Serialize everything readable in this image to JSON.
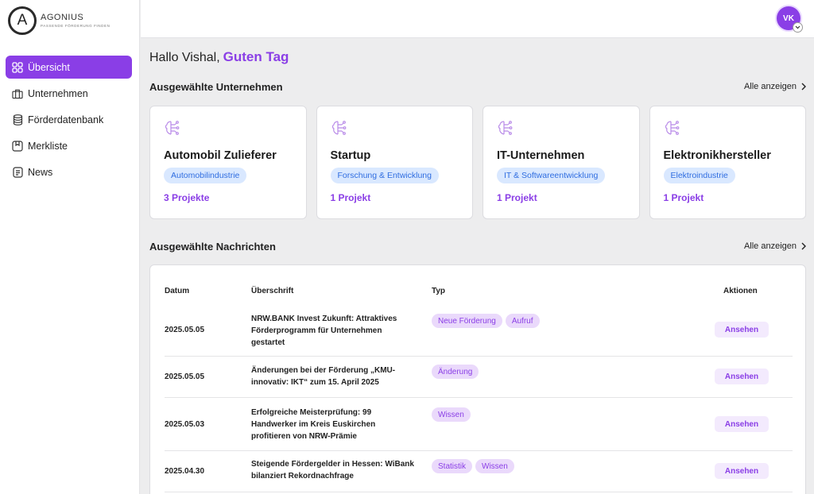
{
  "brand": {
    "letter": "A",
    "name": "AGONIUS",
    "tagline": "PASSENDE FÖRDERUNG FINDEN"
  },
  "nav": [
    {
      "label": "Übersicht",
      "icon": "grid-icon",
      "active": true
    },
    {
      "label": "Unternehmen",
      "icon": "briefcase-icon",
      "active": false
    },
    {
      "label": "Förderdatenbank",
      "icon": "database-icon",
      "active": false
    },
    {
      "label": "Merkliste",
      "icon": "bookmark-icon",
      "active": false
    },
    {
      "label": "News",
      "icon": "document-icon",
      "active": false
    }
  ],
  "user": {
    "initials": "VK"
  },
  "greeting": {
    "text": "Hallo Vishal,",
    "accent": "Guten Tag"
  },
  "companies_section": {
    "title": "Ausgewählte Unternehmen",
    "see_all": "Alle anzeigen"
  },
  "companies": [
    {
      "title": "Automobil Zulieferer",
      "tag": "Automobilindustrie",
      "projects": "3 Projekte"
    },
    {
      "title": "Startup",
      "tag": "Forschung & Entwicklung",
      "projects": "1 Projekt"
    },
    {
      "title": "IT-Unternehmen",
      "tag": "IT & Softwareentwicklung",
      "projects": "1 Projekt"
    },
    {
      "title": "Elektronikhersteller",
      "tag": "Elektroindustrie",
      "projects": "1 Projekt"
    }
  ],
  "news_section": {
    "title": "Ausgewählte Nachrichten",
    "see_all": "Alle anzeigen"
  },
  "news_table": {
    "headers": {
      "date": "Datum",
      "headline": "Überschrift",
      "type": "Typ",
      "actions": "Aktionen"
    },
    "rows": [
      {
        "date": "2025.05.05",
        "headline": "NRW.BANK Invest Zukunft: Attraktives Förderprogramm für Unternehmen gestartet",
        "types": [
          "Neue Förderung",
          "Aufruf"
        ],
        "action": "Ansehen"
      },
      {
        "date": "2025.05.05",
        "headline": "Änderungen bei der Förderung „KMU-innovativ: IKT“ zum 15. April 2025",
        "types": [
          "Änderung"
        ],
        "action": "Ansehen"
      },
      {
        "date": "2025.05.03",
        "headline": "Erfolgreiche Meisterprüfung: 99 Handwerker im Kreis Euskirchen profitieren von NRW-Prämie",
        "types": [
          "Wissen"
        ],
        "action": "Ansehen"
      },
      {
        "date": "2025.04.30",
        "headline": "Steigende Fördergelder in Hessen: WiBank bilanziert Rekordnachfrage",
        "types": [
          "Statistik",
          "Wissen"
        ],
        "action": "Ansehen"
      }
    ]
  },
  "colors": {
    "accent": "#8a3ee6",
    "tag_blue": "#2f6de0",
    "tag_blue_bg": "#d9e8ff",
    "pill_bg": "#ead9fb",
    "background": "#ededee"
  }
}
